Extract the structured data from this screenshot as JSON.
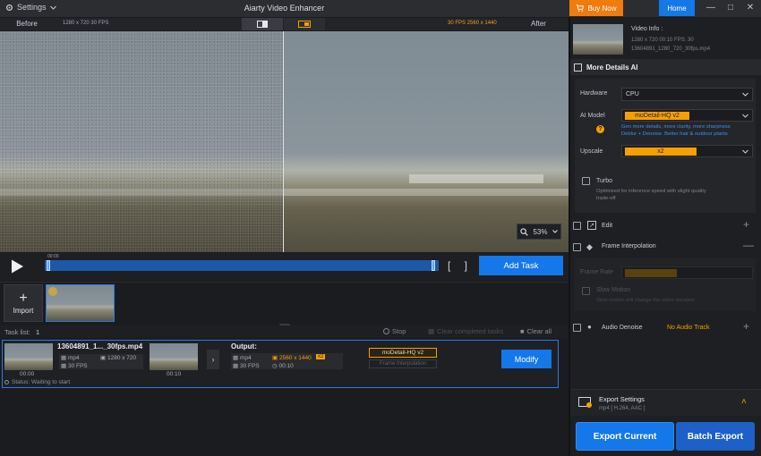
{
  "titlebar": {
    "settings_label": "Settings",
    "title": "Aiarty Video Enhancer",
    "buy_label": "Buy Now",
    "home_label": "Home"
  },
  "compare": {
    "before_label": "Before",
    "before_info": "1280 x 720  30 FPS",
    "after_info": "30 FPS  2560 x 1440",
    "after_label": "After"
  },
  "player": {
    "zoom": "53%",
    "time": "00:00",
    "brackets": "[ ]",
    "add_task": "Add Task"
  },
  "media": {
    "import_label": "Import"
  },
  "tasklist": {
    "label": "Task list:",
    "count": "1",
    "stop": "Stop",
    "clear_completed": "Clear completed tasks",
    "clear_all": "Clear all"
  },
  "task": {
    "filename": "13604891_1..._30fps.mp4",
    "in_format": "mp4",
    "in_res": "1280 x 720",
    "in_fps": "30 FPS",
    "t_start": "00:00",
    "t_end": "00:10",
    "output_label": "Output:",
    "out_format": "mp4",
    "out_res": "2560 x 1440",
    "out_scale": "x2",
    "out_fps": "30 FPS",
    "out_dur": "00:10",
    "model": "moDetail-HQ  v2",
    "frame_interp": "Frame Interpolation",
    "modify": "Modify",
    "status": "Status: Waiting to start"
  },
  "panel": {
    "video_info_label": "Video Info :",
    "video_info_line1": "1280 x 720  00:10   FPS: 30",
    "video_info_line2": "13604891_1280_720_30fps.mp4",
    "more_details": "More Details AI",
    "hardware_label": "Hardware",
    "hardware_value": "CPU",
    "ai_model_label": "AI Model",
    "ai_model_value": "moDetail-HQ  v2",
    "ai_model_desc1": "Gen more details, more clarity, more sharpness",
    "ai_model_desc2": "Deblur + Denoise. Better hair & outdoor plants",
    "upscale_label": "Upscale",
    "upscale_value": "x2",
    "turbo_label": "Turbo",
    "turbo_desc1": "Optimized for inference speed with slight quality",
    "turbo_desc2": "trade-off",
    "edit_label": "Edit",
    "frame_interp_label": "Frame Interpolation",
    "frame_rate_label": "Frame Rate",
    "slow_motion_label": "Slow Motion",
    "slow_motion_desc": "Slow motion will change the video duration",
    "audio_label": "Audio Denoise",
    "audio_value": "No Audio Track",
    "export_settings_label": "Export Settings",
    "export_settings_sub": "mp4 [ H.264, AAC ]",
    "export_current": "Export Current",
    "batch_export": "Batch Export"
  },
  "colors": {
    "accent_blue": "#1477ea",
    "accent_orange": "#f5a000",
    "buy_orange": "#f07c10"
  }
}
